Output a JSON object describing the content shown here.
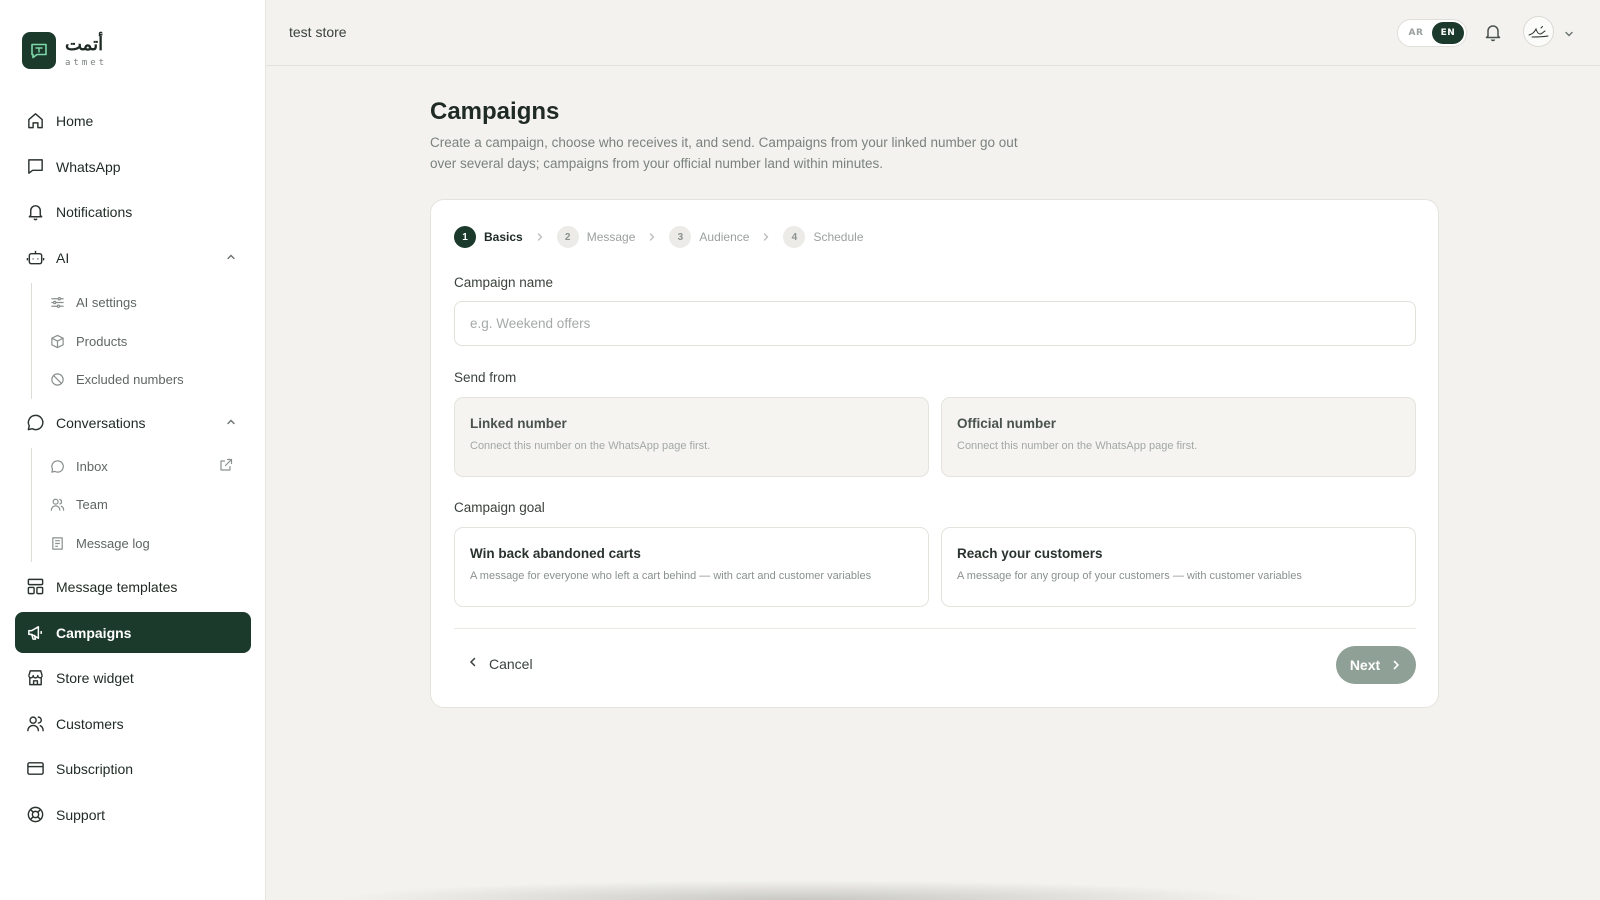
{
  "brand": {
    "name_ar": "أتمت",
    "name_en": "atmet"
  },
  "sidebar": {
    "items": [
      {
        "label": "Home",
        "icon": "home-icon"
      },
      {
        "label": "WhatsApp",
        "icon": "chat-square-icon"
      },
      {
        "label": "Notifications",
        "icon": "bell-icon"
      },
      {
        "label": "AI",
        "icon": "robot-icon",
        "expanded": true
      },
      {
        "label": "Conversations",
        "icon": "chat-bubble-icon",
        "expanded": true
      },
      {
        "label": "Message templates",
        "icon": "template-icon"
      },
      {
        "label": "Campaigns",
        "icon": "megaphone-icon",
        "active": true
      },
      {
        "label": "Store widget",
        "icon": "store-icon"
      },
      {
        "label": "Customers",
        "icon": "users-icon"
      },
      {
        "label": "Subscription",
        "icon": "credit-card-icon"
      },
      {
        "label": "Support",
        "icon": "lifebuoy-icon"
      }
    ],
    "ai_sub": [
      {
        "label": "AI settings",
        "icon": "sliders-icon"
      },
      {
        "label": "Products",
        "icon": "box-icon"
      },
      {
        "label": "Excluded numbers",
        "icon": "ban-icon"
      }
    ],
    "conversations_sub": [
      {
        "label": "Inbox",
        "icon": "chat-bubble-icon",
        "external": true
      },
      {
        "label": "Team",
        "icon": "users-icon"
      },
      {
        "label": "Message log",
        "icon": "log-icon"
      }
    ]
  },
  "topbar": {
    "store_name": "test store",
    "lang": {
      "ar": "AR",
      "en": "EN",
      "selected": "EN"
    }
  },
  "main": {
    "title": "Campaigns",
    "description": "Create a campaign, choose who receives it, and send. Campaigns from your linked number go out over several days; campaigns from your official number land within minutes.",
    "steps": [
      {
        "num": "1",
        "label": "Basics",
        "active": true
      },
      {
        "num": "2",
        "label": "Message"
      },
      {
        "num": "3",
        "label": "Audience"
      },
      {
        "num": "4",
        "label": "Schedule"
      }
    ],
    "campaign_name": {
      "label": "Campaign name",
      "placeholder": "e.g. Weekend offers",
      "value": ""
    },
    "send_from": {
      "label": "Send from",
      "options": [
        {
          "title": "Linked number",
          "desc": "Connect this number on the WhatsApp page first."
        },
        {
          "title": "Official number",
          "desc": "Connect this number on the WhatsApp page first."
        }
      ]
    },
    "campaign_goal": {
      "label": "Campaign goal",
      "options": [
        {
          "title": "Win back abandoned carts",
          "desc": "A message for everyone who left a cart behind — with cart and customer variables"
        },
        {
          "title": "Reach your customers",
          "desc": "A message for any group of your customers — with customer variables"
        }
      ]
    },
    "cancel_label": "Cancel",
    "next_label": "Next"
  },
  "colors": {
    "primary": "#1c3a2c",
    "background": "#f3f2ee",
    "next_disabled": "#8fa096"
  }
}
